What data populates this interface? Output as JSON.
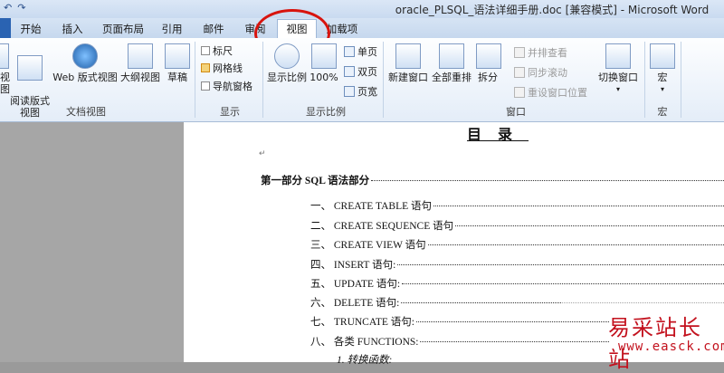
{
  "window": {
    "title": "oracle_PLSQL_语法详细手册.doc [兼容模式] - Microsoft Word",
    "quick_access": [
      "↶",
      "↷"
    ]
  },
  "tabs": [
    {
      "label": "开始"
    },
    {
      "label": "插入"
    },
    {
      "label": "页面布局"
    },
    {
      "label": "引用"
    },
    {
      "label": "邮件"
    },
    {
      "label": "审阅"
    },
    {
      "label": "视图",
      "active": true
    },
    {
      "label": "加载项"
    }
  ],
  "ribbon": {
    "doc_views": {
      "label": "文档视图",
      "buttons": [
        "视图",
        "阅读版式\n视图",
        "Web 版式视图",
        "大纲视图",
        "草稿"
      ]
    },
    "show": {
      "label": "显示",
      "checkboxes": [
        {
          "label": "标尺",
          "checked": false
        },
        {
          "label": "网格线",
          "checked": true
        },
        {
          "label": "导航窗格",
          "checked": false
        }
      ]
    },
    "zoom": {
      "label": "显示比例",
      "zoom_button": "显示比例",
      "hundred_button": "100%",
      "small": [
        "单页",
        "双页",
        "页宽"
      ]
    },
    "window": {
      "label": "窗口",
      "buttons": [
        "新建窗口",
        "全部重排",
        "拆分"
      ],
      "small": [
        "并排查看",
        "同步滚动",
        "重设窗口位置"
      ],
      "switch": "切换窗口"
    },
    "macro": {
      "label": "宏",
      "button": "宏"
    }
  },
  "document": {
    "toc_title": "目录",
    "part_line": "第一部分   SQL 语法部分",
    "entries": [
      "一、  CREATE TABLE 语句",
      "二、  CREATE SEQUENCE 语句",
      "三、  CREATE VIEW 语句",
      "四、  INSERT 语句:",
      "五、  UPDATE 语句:",
      "六、  DELETE 语句:",
      "七、  TRUNCATE 语句:",
      "八、  各类 FUNCTIONS:",
      "1.  转换函数:"
    ]
  },
  "watermark": {
    "text": "易采站长站",
    "url": "www.easck.com"
  },
  "colors": {
    "accent": "#2a63b2",
    "highlight_circle": "#d8140e",
    "watermark": "#c3121e"
  }
}
